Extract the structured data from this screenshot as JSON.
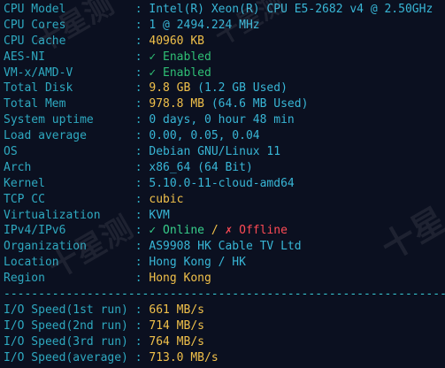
{
  "system": {
    "rows": [
      {
        "label": "CPU Model",
        "value": "Intel(R) Xeon(R) CPU E5-2682 v4 @ 2.50GHz"
      },
      {
        "label": "CPU Cores",
        "value": "1 @ 2494.224 MHz"
      },
      {
        "label": "CPU Cache",
        "value": "40960 KB"
      },
      {
        "label": "AES-NI",
        "value": "✓ Enabled"
      },
      {
        "label": "VM-x/AMD-V",
        "value": "✓ Enabled"
      },
      {
        "label": "Total Disk",
        "value_main": "9.8 GB",
        "value_extra": " (1.2 GB Used)"
      },
      {
        "label": "Total Mem",
        "value_main": "978.8 MB",
        "value_extra": " (64.6 MB Used)"
      },
      {
        "label": "System uptime",
        "value": "0 days, 0 hour 48 min"
      },
      {
        "label": "Load average",
        "value": "0.00, 0.05, 0.04"
      },
      {
        "label": "OS",
        "value": "Debian GNU/Linux 11"
      },
      {
        "label": "Arch",
        "value": "x86_64 (64 Bit)"
      },
      {
        "label": "Kernel",
        "value": "5.10.0-11-cloud-amd64"
      },
      {
        "label": "TCP CC",
        "value": "cubic"
      },
      {
        "label": "Virtualization",
        "value": "KVM"
      },
      {
        "label": "IPv4/IPv6",
        "online": "✓ Online",
        "slash": " / ",
        "offline": "✗ Offline"
      },
      {
        "label": "Organization",
        "value": "AS9908 HK Cable TV Ltd"
      },
      {
        "label": "Location",
        "value": "Hong Kong / HK"
      },
      {
        "label": "Region",
        "value": "Hong Kong"
      }
    ]
  },
  "divider": "----------------------------------------------------------------------",
  "io": {
    "rows": [
      {
        "label": "I/O Speed(1st run)",
        "value": "661 MB/s"
      },
      {
        "label": "I/O Speed(2nd run)",
        "value": "714 MB/s"
      },
      {
        "label": "I/O Speed(3rd run)",
        "value": "764 MB/s"
      },
      {
        "label": "I/O Speed(average)",
        "value": "713.0 MB/s"
      }
    ]
  },
  "watermarks": [
    "十星测",
    "十星测",
    "十星测",
    "十星"
  ],
  "colors": {
    "background": "#0b1020",
    "label": "#2ea9c0",
    "value": "#38b6d6",
    "yellow": "#f0c04a",
    "green": "#37cf8b",
    "red": "#ff4b55"
  }
}
